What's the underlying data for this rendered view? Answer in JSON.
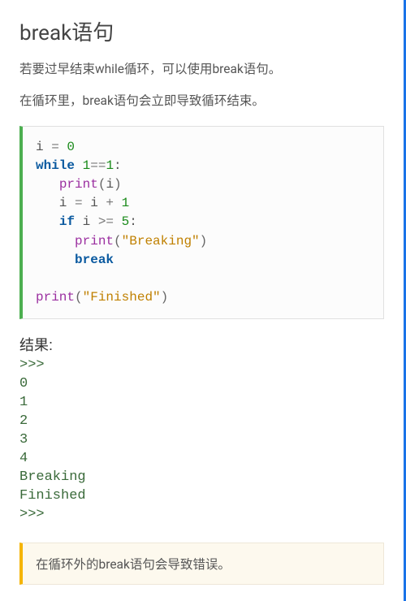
{
  "title": "break语句",
  "paragraphs": [
    "若要过早结束while循环，可以使用break语句。",
    "在循环里，break语句会立即导致循环结束。"
  ],
  "code": {
    "lines": [
      [
        {
          "t": "plain",
          "v": "i "
        },
        {
          "t": "op",
          "v": "= "
        },
        {
          "t": "num",
          "v": "0"
        }
      ],
      [
        {
          "t": "kw",
          "v": "while"
        },
        {
          "t": "plain",
          "v": " "
        },
        {
          "t": "num",
          "v": "1"
        },
        {
          "t": "op",
          "v": "=="
        },
        {
          "t": "num",
          "v": "1"
        },
        {
          "t": "plain",
          "v": ":"
        }
      ],
      [
        {
          "t": "plain",
          "v": "   "
        },
        {
          "t": "fn",
          "v": "print"
        },
        {
          "t": "paren",
          "v": "("
        },
        {
          "t": "plain",
          "v": "i"
        },
        {
          "t": "paren",
          "v": ")"
        }
      ],
      [
        {
          "t": "plain",
          "v": "   i "
        },
        {
          "t": "op",
          "v": "= "
        },
        {
          "t": "plain",
          "v": "i "
        },
        {
          "t": "op",
          "v": "+ "
        },
        {
          "t": "num",
          "v": "1"
        }
      ],
      [
        {
          "t": "plain",
          "v": "   "
        },
        {
          "t": "kw",
          "v": "if"
        },
        {
          "t": "plain",
          "v": " i "
        },
        {
          "t": "op",
          "v": ">= "
        },
        {
          "t": "num",
          "v": "5"
        },
        {
          "t": "plain",
          "v": ":"
        }
      ],
      [
        {
          "t": "plain",
          "v": "     "
        },
        {
          "t": "fn",
          "v": "print"
        },
        {
          "t": "paren",
          "v": "("
        },
        {
          "t": "str",
          "v": "\"Breaking\""
        },
        {
          "t": "paren",
          "v": ")"
        }
      ],
      [
        {
          "t": "plain",
          "v": "     "
        },
        {
          "t": "kw",
          "v": "break"
        }
      ],
      [
        {
          "t": "plain",
          "v": ""
        }
      ],
      [
        {
          "t": "fn",
          "v": "print"
        },
        {
          "t": "paren",
          "v": "("
        },
        {
          "t": "str",
          "v": "\"Finished\""
        },
        {
          "t": "paren",
          "v": ")"
        }
      ]
    ]
  },
  "result_label": "结果:",
  "result_lines": [
    ">>>",
    "0",
    "1",
    "2",
    "3",
    "4",
    "Breaking",
    "Finished",
    ">>>"
  ],
  "note": "在循环外的break语句会导致错误。"
}
